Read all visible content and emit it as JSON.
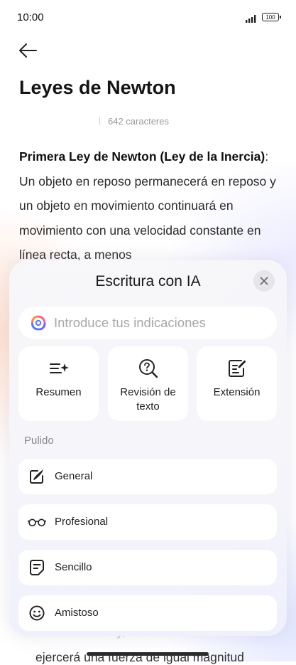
{
  "status_bar": {
    "time": "10:00",
    "battery": "100"
  },
  "document": {
    "title": "Leyes de Newton",
    "char_count": "642 caracteres",
    "heading_bold": "Primera Ley de Newton (Ley de la Inercia)",
    "heading_colon": ":",
    "body": "Un objeto en reposo permanecerá en reposo y un objeto en movimiento continuará en movimiento con una velocidad constante en línea recta, a menos",
    "partial_line": "...y, ... ...",
    "bottom_line": "ejercerá una fuerza de igual magnitud"
  },
  "ai_panel": {
    "title": "Escritura con IA",
    "prompt_placeholder": "Introduce tus indicaciones",
    "actions": [
      {
        "label": "Resumen",
        "icon": "summary-sparkle-icon"
      },
      {
        "label": "Revisión de texto",
        "icon": "magnifier-question-icon"
      },
      {
        "label": "Extensión",
        "icon": "document-edit-icon"
      }
    ],
    "section_label": "Pulido",
    "options": [
      {
        "label": "General",
        "icon": "pen-square-icon"
      },
      {
        "label": "Profesional",
        "icon": "glasses-icon"
      },
      {
        "label": "Sencillo",
        "icon": "note-icon"
      },
      {
        "label": "Amistoso",
        "icon": "smile-icon"
      }
    ]
  }
}
